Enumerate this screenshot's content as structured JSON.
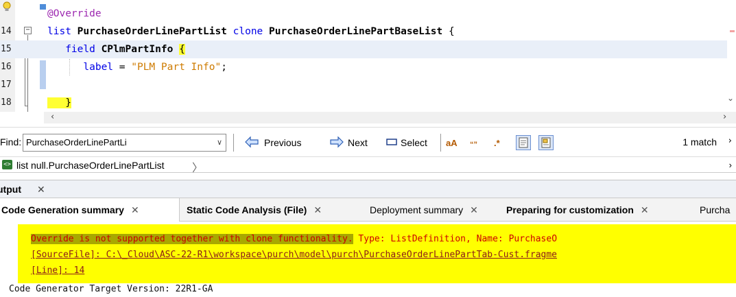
{
  "editor": {
    "lines": [
      {
        "num": "",
        "parts": [
          {
            "cls": "ann",
            "text": "@Override"
          }
        ]
      },
      {
        "num": "14",
        "parts": [
          {
            "cls": "kw",
            "text": "list "
          },
          {
            "cls": "nm",
            "text": "PurchaseOrderLinePartList "
          },
          {
            "cls": "kw",
            "text": "clone "
          },
          {
            "cls": "nm",
            "text": "PurchaseOrderLinePartBaseList "
          },
          {
            "cls": "",
            "text": "{"
          }
        ]
      },
      {
        "num": "15",
        "parts": [
          {
            "cls": "kw",
            "text": "   field "
          },
          {
            "cls": "nm",
            "text": "CPlmPartInfo "
          },
          {
            "cls": "brace-hl",
            "text": "{"
          }
        ]
      },
      {
        "num": "16",
        "parts": [
          {
            "cls": "kw",
            "text": "      label "
          },
          {
            "cls": "",
            "text": "= "
          },
          {
            "cls": "str",
            "text": "\"PLM Part Info\""
          },
          {
            "cls": "",
            "text": ";"
          }
        ]
      },
      {
        "num": "17",
        "parts": []
      },
      {
        "num": "18",
        "parts": [
          {
            "cls": "brace-hl",
            "text": "   }"
          }
        ]
      }
    ]
  },
  "findbar": {
    "label": "Find:",
    "query": "PurchaseOrderLinePartLi",
    "previous_label": "Previous",
    "next_label": "Next",
    "select_label": "Select",
    "match_text": "1 match"
  },
  "breadcrumb": {
    "text": "list null.PurchaseOrderLinePartList"
  },
  "output": {
    "title": "utput",
    "tabs": [
      {
        "label": "Code Generation summary",
        "bold": true,
        "active": true
      },
      {
        "label": "Static Code Analysis (File)",
        "bold": true,
        "active": false
      },
      {
        "label": "Deployment summary",
        "bold": false,
        "active": false
      },
      {
        "label": "Preparing for customization",
        "bold": true,
        "active": false
      },
      {
        "label": "Purcha",
        "bold": false,
        "active": false
      }
    ],
    "message_highlight": "Override is not supported together with clone functionality.",
    "message_rest": " Type: ListDefinition, Name: PurchaseO",
    "source_file": "[SourceFile]: C:\\_Cloud\\ASC-22-R1\\workspace\\purch\\model\\purch\\PurchaseOrderLinePartTab-Cust.fragme",
    "line_ref": "[Line]: 14",
    "target_version": "Code Generator Target Version: 22R1-GA"
  },
  "colors": {
    "keyword": "#0000e6",
    "annotation": "#9c27b0",
    "string": "#ce7b00",
    "warning_bg": "#ffff00",
    "error_text": "#cc0000"
  }
}
